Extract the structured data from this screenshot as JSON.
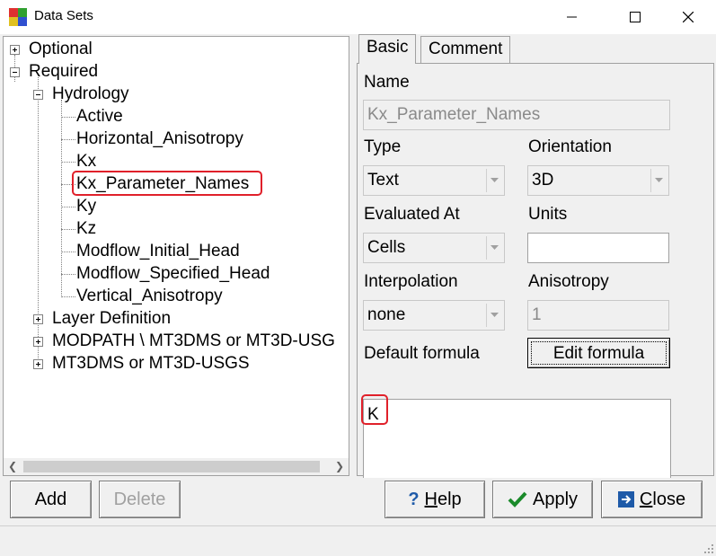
{
  "window": {
    "title": "Data Sets",
    "minimize_icon": "minimize-icon",
    "maximize_icon": "maximize-icon",
    "close_icon": "close-icon"
  },
  "tree": {
    "optional": "Optional",
    "required": "Required",
    "hydrology": "Hydrology",
    "children": [
      "Active",
      "Horizontal_Anisotropy",
      "Kx",
      "Kx_Parameter_Names",
      "Ky",
      "Kz",
      "Modflow_Initial_Head",
      "Modflow_Specified_Head",
      "Vertical_Anisotropy"
    ],
    "layer_definition": "Layer Definition",
    "modpath": "MODPATH \\ MT3DMS or MT3D-USG",
    "mt3dms": "MT3DMS or MT3D-USGS",
    "selected": "Kx_Parameter_Names"
  },
  "tabs": {
    "basic": "Basic",
    "comment": "Comment"
  },
  "form": {
    "name_label": "Name",
    "name_value": "Kx_Parameter_Names",
    "type_label": "Type",
    "type_value": "Text",
    "orientation_label": "Orientation",
    "orientation_value": "3D",
    "evaluated_label": "Evaluated At",
    "evaluated_value": "Cells",
    "units_label": "Units",
    "units_value": "",
    "interpolation_label": "Interpolation",
    "interpolation_value": "none",
    "anisotropy_label": "Anisotropy",
    "anisotropy_value": "1",
    "default_formula_label": "Default formula",
    "edit_formula_label": "Edit formula",
    "formula_value": "K"
  },
  "buttons": {
    "add": "Add",
    "delete": "Delete",
    "help_underlined": "H",
    "help_rest": "elp",
    "apply": "Apply",
    "close_underlined": "C",
    "close_rest": "lose"
  },
  "colors": {
    "highlight": "#e0202a",
    "help_icon": "#1e5aa8",
    "apply_check": "#1a8a2a",
    "close_icon": "#1e5aa8"
  }
}
